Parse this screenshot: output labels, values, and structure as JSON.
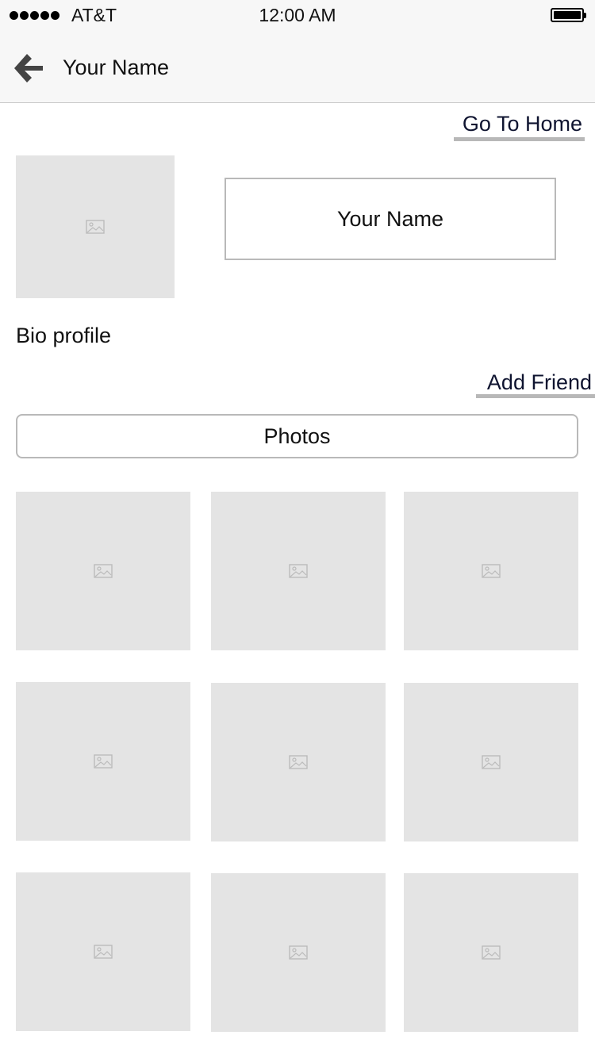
{
  "status_bar": {
    "carrier": "AT&T",
    "time": "12:00 AM",
    "signal_bars": 5,
    "battery_level": 1.0
  },
  "nav": {
    "back_icon": "arrow-left-icon",
    "title": "Your Name"
  },
  "links": {
    "go_home": "Go To Home",
    "add_friend": "Add Friend"
  },
  "profile": {
    "avatar_icon": "image-placeholder-icon",
    "name": "Your Name",
    "bio": "Bio profile"
  },
  "photos": {
    "button_label": "Photos",
    "grid_count": 9,
    "placeholder_icon": "image-placeholder-icon"
  },
  "colors": {
    "placeholder_bg": "#e4e4e4",
    "link_text": "#0f1430",
    "link_underline": "#b8b8b8",
    "border": "#b9b9b9",
    "bar_bg": "#f7f7f7"
  }
}
